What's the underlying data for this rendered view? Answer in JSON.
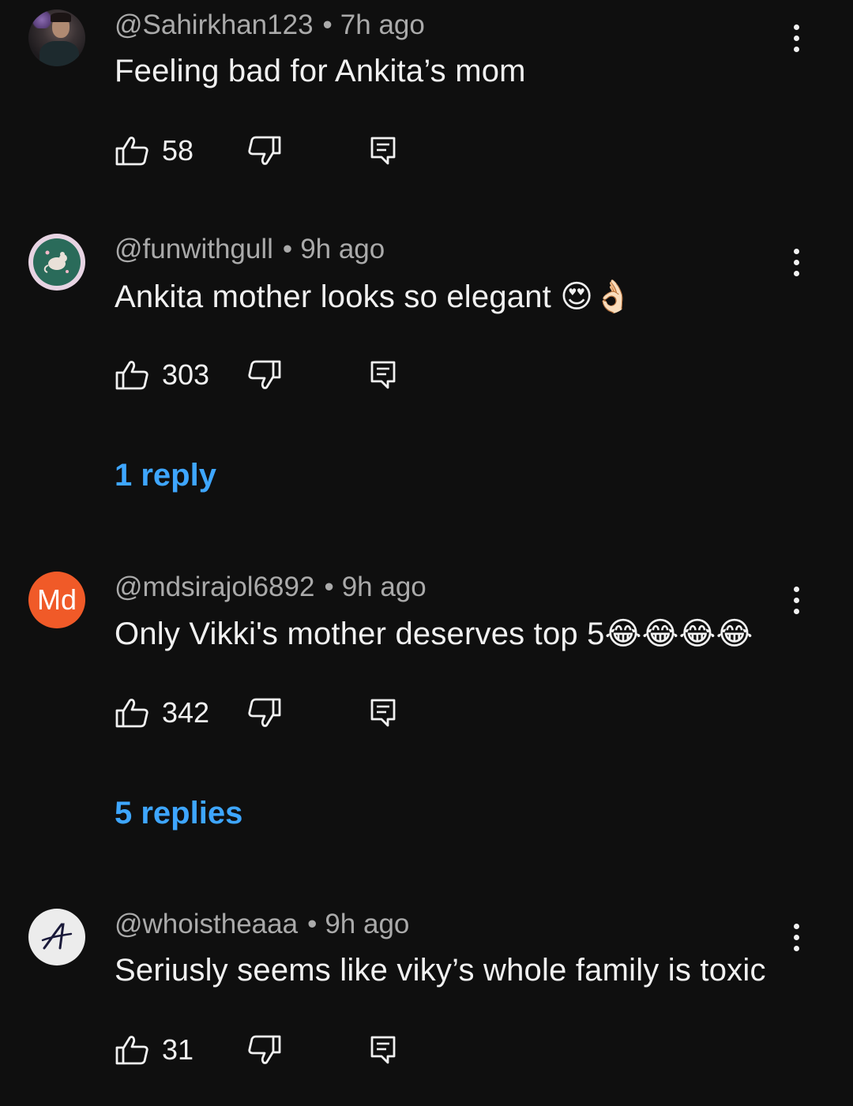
{
  "comments": [
    {
      "username": "@Sahirkhan123",
      "time": "7h ago",
      "separator": "•",
      "text": "Feeling bad for Ankita’s mom",
      "likes": "58",
      "replies_label": "",
      "avatar_type": "photo"
    },
    {
      "username": "@funwithgull",
      "time": "9h ago",
      "separator": "•",
      "text": "Ankita mother looks so elegant 😍👌🏻",
      "likes": "303",
      "replies_label": "1 reply",
      "avatar_type": "badge"
    },
    {
      "username": "@mdsirajol6892",
      "time": "9h ago",
      "separator": "•",
      "text": "Only Vikki's mother deserves top 5😂😂😂😂",
      "likes": "342",
      "replies_label": "5 replies",
      "avatar_type": "initials",
      "avatar_initials": "Md"
    },
    {
      "username": "@whoistheaaa",
      "time": "9h ago",
      "separator": "•",
      "text": "Seriusly seems like viky’s whole family is toxic",
      "likes": "31",
      "replies_label": "",
      "avatar_type": "logo"
    }
  ],
  "icons": {
    "like": "thumbs-up-icon",
    "dislike": "thumbs-down-icon",
    "reply": "reply-comment-icon",
    "more": "more-vertical-icon"
  },
  "colors": {
    "background": "#0f0f0f",
    "text": "#f1f1f1",
    "meta": "#aaaaaa",
    "link": "#3ea6ff",
    "initials_avatar": "#f05a28"
  }
}
